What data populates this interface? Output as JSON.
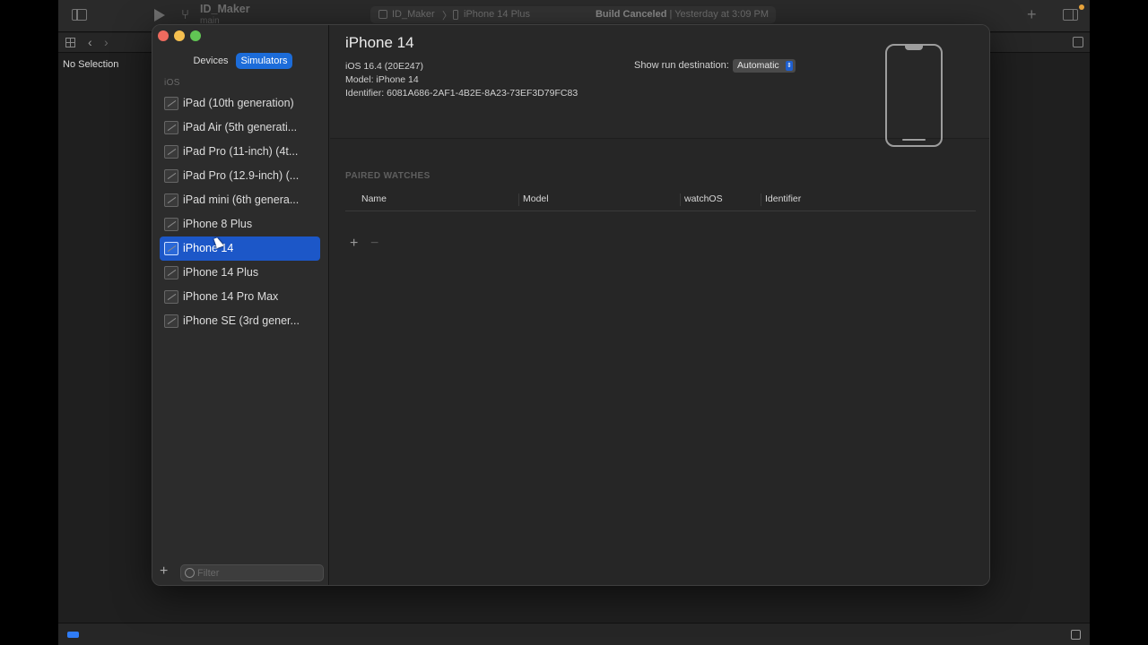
{
  "xcode": {
    "scheme_name": "ID_Maker",
    "scheme_branch": "main",
    "activity": {
      "scheme": "ID_Maker",
      "separator": "〉",
      "destination": "iPhone 14 Plus",
      "status_bold": "Build Canceled",
      "status_rest": "| Yesterday at 3:09 PM"
    },
    "no_selection": "No Selection"
  },
  "devices_window": {
    "segments": {
      "devices": "Devices",
      "simulators": "Simulators"
    },
    "ios_header": "iOS",
    "simulators": [
      {
        "label": "iPad (10th generation)",
        "selected": false
      },
      {
        "label": "iPad Air (5th generati...",
        "selected": false
      },
      {
        "label": "iPad Pro (11-inch) (4t...",
        "selected": false
      },
      {
        "label": "iPad Pro (12.9-inch) (...",
        "selected": false
      },
      {
        "label": "iPad mini (6th genera...",
        "selected": false
      },
      {
        "label": "iPhone 8 Plus",
        "selected": false
      },
      {
        "label": "iPhone 14",
        "selected": true
      },
      {
        "label": "iPhone 14 Plus",
        "selected": false
      },
      {
        "label": "iPhone 14 Pro Max",
        "selected": false
      },
      {
        "label": "iPhone SE (3rd gener...",
        "selected": false
      }
    ],
    "filter_placeholder": "Filter",
    "filter_value": "",
    "add_symbol": "+",
    "detail": {
      "title": "iPhone 14",
      "os_version": "iOS 16.4 (20E247)",
      "model": "Model: iPhone 14",
      "identifier": "Identifier: 6081A686-2AF1-4B2E-8A23-73EF3D79FC83",
      "show_run_label": "Show run destination:",
      "run_destination": "Automatic",
      "paired_watches_header": "PAIRED WATCHES",
      "columns": [
        "Name",
        "Model",
        "watchOS",
        "Identifier"
      ],
      "add_symbol": "+",
      "remove_symbol": "−"
    }
  },
  "colors": {
    "accent": "#1c6cd9",
    "selection": "#1c57c8",
    "close": "#ed6a5e",
    "minimize": "#f5bf4f",
    "maximize": "#61c554"
  }
}
